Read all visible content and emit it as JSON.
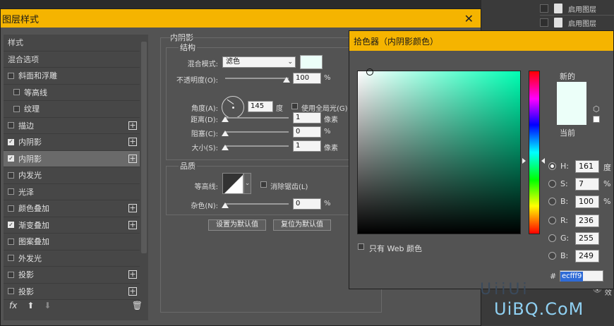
{
  "background": {
    "layer_rows": [
      "启用图层",
      "启用图层"
    ],
    "partial_label": "效"
  },
  "layer_style": {
    "title": "图层样式",
    "styles_header": "样式",
    "blend_options": "混合选项",
    "items": [
      {
        "label": "斜面和浮雕",
        "checked": false,
        "sub": false,
        "plus": false
      },
      {
        "label": "等高线",
        "checked": false,
        "sub": true,
        "plus": false
      },
      {
        "label": "纹理",
        "checked": false,
        "sub": true,
        "plus": false
      },
      {
        "label": "描边",
        "checked": false,
        "sub": false,
        "plus": true
      },
      {
        "label": "内阴影",
        "checked": true,
        "sub": false,
        "plus": true
      },
      {
        "label": "内阴影",
        "checked": true,
        "sub": false,
        "plus": true,
        "selected": true
      },
      {
        "label": "内发光",
        "checked": false,
        "sub": false,
        "plus": false
      },
      {
        "label": "光泽",
        "checked": false,
        "sub": false,
        "plus": false
      },
      {
        "label": "颜色叠加",
        "checked": false,
        "sub": false,
        "plus": true
      },
      {
        "label": "渐变叠加",
        "checked": true,
        "sub": false,
        "plus": true
      },
      {
        "label": "图案叠加",
        "checked": false,
        "sub": false,
        "plus": false
      },
      {
        "label": "外发光",
        "checked": false,
        "sub": false,
        "plus": false
      },
      {
        "label": "投影",
        "checked": false,
        "sub": false,
        "plus": true
      },
      {
        "label": "投影",
        "checked": false,
        "sub": false,
        "plus": true
      }
    ],
    "footer": {
      "fx": "fx",
      "up": "⬆",
      "down": "⬇",
      "trash": "🗑"
    },
    "inner_shadow": {
      "title": "内阴影",
      "structure": "结构",
      "blend_mode_label": "混合模式:",
      "blend_mode_value": "滤色",
      "color": "#ecfff9",
      "opacity_label": "不透明度(O):",
      "opacity_value": "100",
      "opacity_unit": "%",
      "angle_label": "角度(A):",
      "angle_value": "145",
      "angle_unit": "度",
      "global_light_label": "使用全局光(G)",
      "distance_label": "距离(D):",
      "distance_value": "1",
      "distance_unit": "像素",
      "choke_label": "阻塞(C):",
      "choke_value": "0",
      "choke_unit": "%",
      "size_label": "大小(S):",
      "size_value": "1",
      "size_unit": "像素",
      "quality": "品质",
      "contour_label": "等高线:",
      "antialias_label": "消除锯齿(L)",
      "noise_label": "杂色(N):",
      "noise_value": "0",
      "noise_unit": "%",
      "set_default": "设置为默认值",
      "reset_default": "复位为默认值"
    }
  },
  "color_picker": {
    "title": "拾色器（内阴影颜色）",
    "new_label": "新的",
    "current_label": "当前",
    "new_color": "#ecfff9",
    "current_color": "#ecfff9",
    "web_only_label": "只有 Web 颜色",
    "fields": [
      {
        "key": "H:",
        "value": "161",
        "unit": "度",
        "on": true
      },
      {
        "key": "S:",
        "value": "7",
        "unit": "%",
        "on": false
      },
      {
        "key": "B:",
        "value": "100",
        "unit": "%",
        "on": false
      },
      {
        "key": "R:",
        "value": "236",
        "unit": "",
        "on": false
      },
      {
        "key": "G:",
        "value": "255",
        "unit": "",
        "on": false
      },
      {
        "key": "B:",
        "value": "249",
        "unit": "",
        "on": false
      }
    ],
    "hex_label": "#",
    "hex_value": "ecfff9"
  },
  "watermark": {
    "text": "UiBQ.CoM",
    "sub": "UiiUi"
  }
}
